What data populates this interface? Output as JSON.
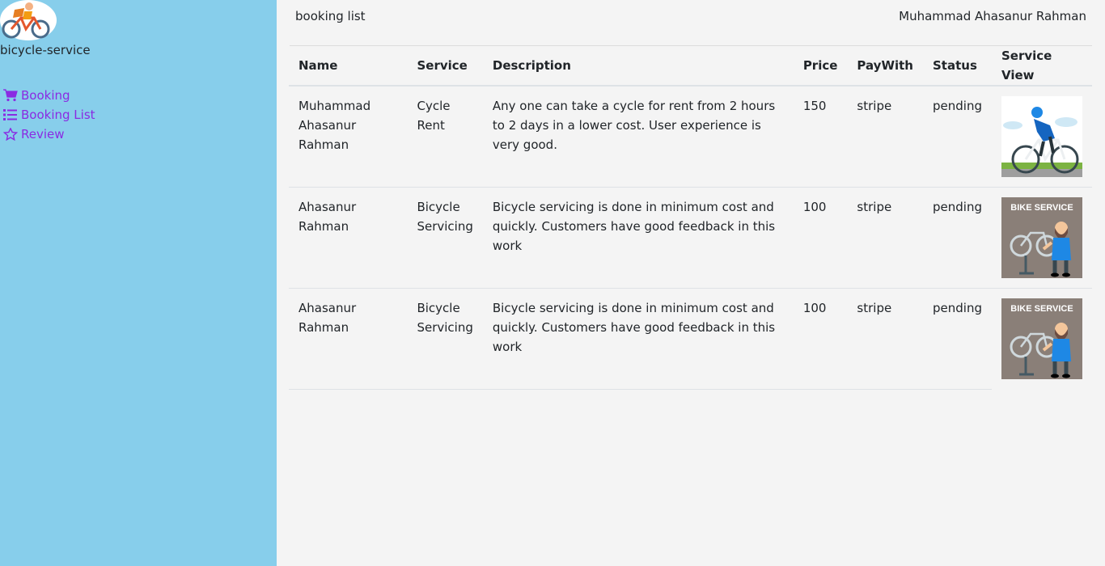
{
  "sidebar": {
    "brand": "bicycle-service",
    "items": [
      {
        "label": "Booking",
        "icon": "cart-icon"
      },
      {
        "label": "Booking List",
        "icon": "list-icon"
      },
      {
        "label": "Review",
        "icon": "star-icon"
      }
    ],
    "colors": {
      "background": "#87ceeb",
      "link": "#8a2be2"
    }
  },
  "header": {
    "title": "booking list",
    "user": "Muhammad Ahasanur Rahman"
  },
  "table": {
    "columns": [
      "Name",
      "Service",
      "Description",
      "Price",
      "PayWith",
      "Status",
      "Service View"
    ],
    "rows": [
      {
        "name": "Muhammad Ahasanur Rahman",
        "service": "Cycle Rent",
        "description": "Any one can take a cycle for rent from 2 hours to 2 days in a lower cost. User experience is very good.",
        "price": "150",
        "paywith": "stripe",
        "status": "pending",
        "image": "cyclist-image"
      },
      {
        "name": "Ahasanur Rahman",
        "service": "Bicycle Servicing",
        "description": "Bicycle servicing is done in minimum cost and quickly. Customers have good feedback in this work",
        "price": "100",
        "paywith": "stripe",
        "status": "pending",
        "image": "bike-service-image",
        "image_text": "BIKE SERVICE"
      },
      {
        "name": "Ahasanur Rahman",
        "service": "Bicycle Servicing",
        "description": "Bicycle servicing is done in minimum cost and quickly. Customers have good feedback in this work",
        "price": "100",
        "paywith": "stripe",
        "status": "pending",
        "image": "bike-service-image",
        "image_text": "BIKE SERVICE"
      }
    ]
  }
}
